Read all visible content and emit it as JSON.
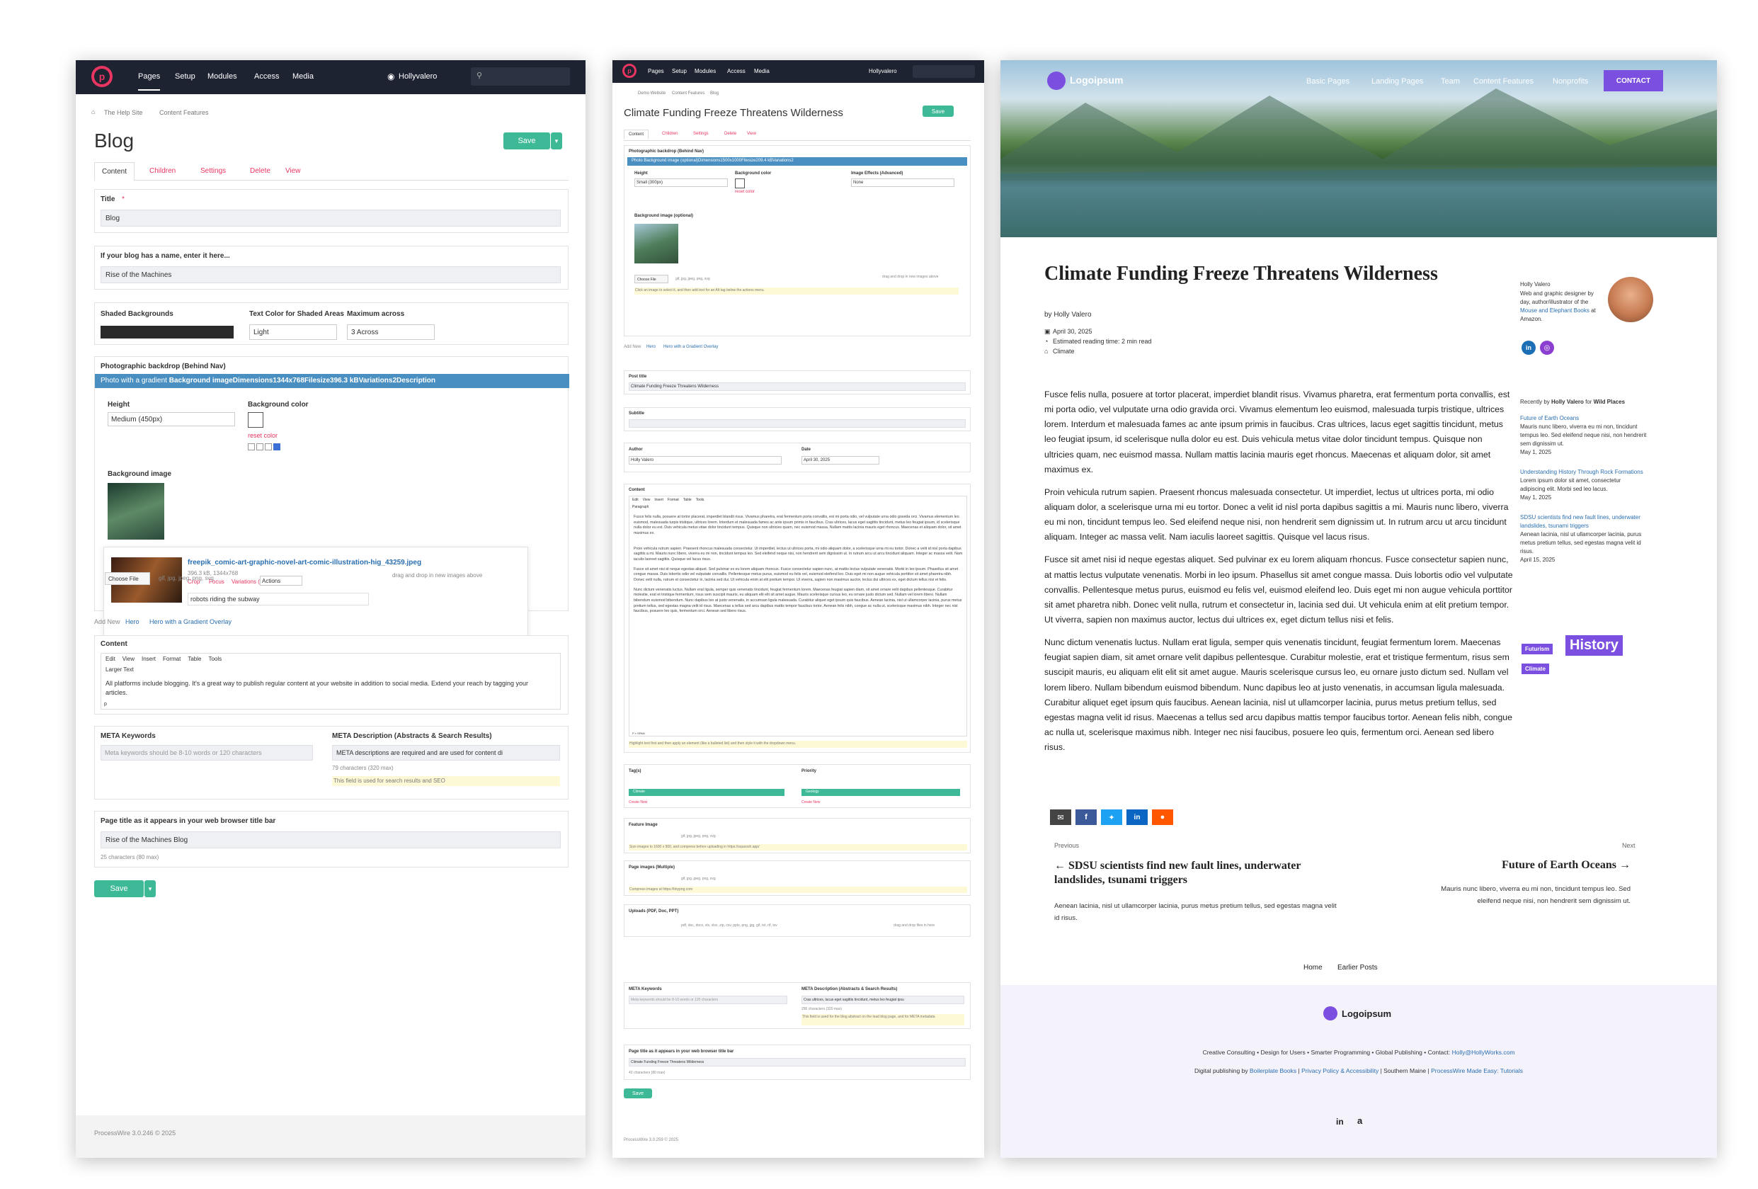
{
  "p1": {
    "nav": {
      "items": [
        "Pages",
        "Setup",
        "Modules",
        "Access",
        "Media"
      ],
      "user": "Hollyvalero"
    },
    "breadcrumb": [
      "The Help Site",
      "Content Features"
    ],
    "page_title": "Blog",
    "save": "Save",
    "tabs": [
      "Content",
      "Children",
      "Settings",
      "Delete",
      "View"
    ],
    "title_label": "Title",
    "title_value": "Blog",
    "blogname_label": "If your blog has a name, enter it here...",
    "blogname_value": "Rise of the Machines",
    "shaded_label": "Shaded Backgrounds",
    "textcolor_label": "Text Color for Shaded Areas",
    "textcolor_value": "Light",
    "maxacross_label": "Maximum across",
    "maxacross_value": "3 Across",
    "photo_label": "Photographic backdrop (Behind Nav)",
    "photo_bar_prefix": "Photo with a gradient",
    "photo_bar_rest": "Background imageDimensions1344x768Filesize396.3 kBVariations2Description",
    "height_label": "Height",
    "height_value": "Medium (450px)",
    "bgcolor_label": "Background color",
    "reset_color": "reset color",
    "bgimage_label": "Background image",
    "file_name": "freepik_comic-art-graphic-novel-art-comic-illustration-hig_43259.jpeg",
    "file_meta": "396.3 kB, 1344x768",
    "crop": "Crop",
    "focus": "Focus",
    "variations": "Variations (2)",
    "actions": "Actions",
    "file_desc": "robots riding the subway",
    "choose_file": "Choose File",
    "file_types": "gif, jpg, jpeg, png, svg",
    "drag_drop": "drag and drop in new images above",
    "add_new": "Add New",
    "add_hero": "Hero",
    "add_hero_grad": "Hero with a Gradient Overlay",
    "content_label": "Content",
    "editor_menu": [
      "Edit",
      "View",
      "Insert",
      "Format",
      "Table",
      "Tools"
    ],
    "editor_style": "Larger Text",
    "editor_text": "All platforms include blogging. It's a great way to publish regular content at your website in addition to social media. Extend your reach by tagging your articles.",
    "editor_path": "p",
    "meta_kw_label": "META Keywords",
    "meta_kw_ph": "Meta keywords should be 8-10 words or 120 characters",
    "meta_desc_label": "META Description (Abstracts & Search Results)",
    "meta_desc_value": "META descriptions are required and are used for content di",
    "meta_desc_count": "79 characters (320 max)",
    "meta_desc_note": "This field is used for search results and SEO",
    "browser_title_label": "Page title as it appears in your web browser title bar",
    "browser_title_value": "Rise of the Machines Blog",
    "browser_title_count": "25 characters (80 max)",
    "footer": "ProcessWire 3.0.246 © 2025"
  },
  "p2": {
    "nav": {
      "items": [
        "Pages",
        "Setup",
        "Modules",
        "Access",
        "Media"
      ],
      "user": "Hollyvalero"
    },
    "breadcrumb": [
      "Demo Website",
      "Content Features",
      "Blog"
    ],
    "page_title": "Climate Funding Freeze Threatens Wilderness",
    "save": "Save",
    "tabs": [
      "Content",
      "Children",
      "Settings",
      "Delete",
      "View"
    ],
    "photo_label": "Photographic backdrop (Behind Nav)",
    "photo_bar": "Photo Background image (optional)Dimensions1500x1000Filesize209.4 kBVariations2",
    "height_label": "Height",
    "height_value": "Small (300px)",
    "bgcolor_label": "Background color",
    "reset_color": "reset color",
    "effects_label": "Image Effects (Advanced)",
    "effects_value": "None",
    "bgimage_label": "Background image (optional)",
    "choose_file": "Choose File",
    "file_types": "gif, jpg, jpeg, png, svg",
    "drag_drop": "drag and drop in new images above",
    "click_note": "Click an image to select it, and then add text for an Alt tag below the actions menu.",
    "add_new": "Add New",
    "add_hero": "Hero",
    "add_hero_grad": "Hero with a Gradient Overlay",
    "post_title_label": "Post title",
    "post_title_value": "Climate Funding Freeze Threatens Wilderness",
    "subtitle_label": "Subtitle",
    "author_label": "Author",
    "author_value": "Holly Valero",
    "date_label": "Date",
    "date_value": "April 30, 2025",
    "content_label": "Content",
    "editor_menu": [
      "Edit",
      "View",
      "Insert",
      "Format",
      "Table",
      "Tools"
    ],
    "editor_style": "Paragraph",
    "para1": "Fusce felis nulla, posuere at tortor placerat, imperdiet blandit risus. Vivamus pharetra, erat fermentum porta convallis, est mi porta odio, vel vulputate urna odio gravida orci. Vivamus elementum leo euismod, malesuada turpis tristique, ultrices lorem. Interdum et malesuada fames ac ante ipsum primis in faucibus. Cras ultrices, lacus eget sagittis tincidunt, metus leo feugiat ipsum, id scelerisque nulla dolor eu est. Duis vehicula metus vitae dolor tincidunt tempus. Quisque non ultricies quam, nec euismod massa. Nullam mattis lacinia mauris eget rhoncus. Maecenas et aliquam dolor, sit amet maximus ex.",
    "para2": "Proin vehicula rutrum sapien. Praesent rhoncus malesuada consectetur. Ut imperdiet, lectus ut ultrices porta, mi odio aliquam dolor, a scelerisque urna mi eu tortor. Donec a velit id nisl porta dapibus sagittis a mi. Mauris nunc libero, viverra eu mi non, tincidunt tempus leo. Sed eleifend neque nisi, non hendrerit sem dignissim ut. In rutrum arcu ut arcu tincidunt aliquam. Integer ac massa velit. Nam iaculis laoreet sagittis. Quisque vel lacus risus.",
    "para3": "Fusce sit amet nisi id neque egestas aliquet. Sed pulvinar ex eu lorem aliquam rhoncus. Fusce consectetur sapien nunc, at mattis lectus vulputate venenatis. Morbi in leo ipsum. Phasellus sit amet congue massa. Duis lobortis odio vel vulputate convallis. Pellentesque metus purus, euismod eu felis vel, euismod eleifend leo. Duis eget mi non augue vehicula porttitor sit amet pharetra nibh. Donec velit nulla, rutrum et consectetur in, lacinia sed dui. Ut vehicula enim at elit pretium tempor. Ut viverra, sapien non maximus auctor, lectus dui ultrices ex, eget dictum tellus nisi et felis.",
    "para4": "Nunc dictum venenatis luctus. Nullam erat ligula, semper quis venenatis tincidunt, feugiat fermentum lorem. Maecenas feugiat sapien diam, sit amet ornare velit dapibus pellentesque. Curabitur molestie, erat et tristique fermentum, risus sem suscipit mauris, eu aliquam elit elit sit amet augue. Mauris scelerisque cursus leo, eu ornare justo dictum sed. Nullam vel lorem libero. Nullam bibendum euismod bibendum. Nunc dapibus leo at justo venenatis, in accumsan ligula malesuada. Curabitur aliquet eget ipsum quis faucibus. Aenean lacinia, nisl ut ullamcorper lacinia, purus metus pretium tellus, sed egestas magna velit id risus. Maecenas a tellus sed arcu dapibus mattis tempor faucibus tortor. Aenean felis nibh, congue ac nulla ut, scelerisque maximus nibh. Integer nec nisi faucibus, posuere leo quis, fermentum orci. Aenean sed libero risus.",
    "editor_path": "P » SPAN",
    "editor_note": "Highlight text first and then apply an element (like a bulleted list) and then style it with the dropdown menu.",
    "tags_label": "Tag(s)",
    "tag_value": "Climate",
    "create_new": "Create New",
    "priority_label": "Priority",
    "priority_value": "Geology",
    "feature_label": "Feature Image",
    "feature_types": "gif, jpg, jpeg, png, svg",
    "feature_note": "Size images to 1600 x 900, and compress before uploading in https://squoosh.app/",
    "pageimages_label": "Page images (Multiple)",
    "pageimages_types": "gif, jpg, jpeg, png, svg",
    "pageimages_note": "Compress images at https://tinypng.com",
    "uploads_label": "Uploads (PDF, Doc, PPT)",
    "uploads_types": "pdf, doc, docx, xls, xlsx, zip, csv, pptx, png, jpg, gif, txt, rtf, tsv",
    "uploads_drag": "drag and drop files in here",
    "meta_kw_label": "META Keywords",
    "meta_kw_ph": "Meta keywords should be 8-10 words or 120 characters",
    "meta_desc_label": "META Description (Abstracts & Search Results)",
    "meta_desc_value": "Cras ultrices, lacus eget sagittis tincidunt, metus leo feugiat ipsu",
    "meta_desc_count": "290 characters (320 max)",
    "meta_desc_note": "This field is used for the blog abstract on the lead blog page, and for META metadata",
    "browser_title_label": "Page title as it appears in your web browser title bar",
    "browser_title_value": "Climate Funding Freeze Threatens Wilderness",
    "browser_title_count": "43 characters (80 max)",
    "footer": "ProcessWire 3.0.259 © 2025"
  },
  "p3": {
    "logo": "Logoipsum",
    "nav": [
      "Basic Pages",
      "Landing Pages",
      "Team",
      "Content Features",
      "Nonprofits"
    ],
    "contact": "CONTACT",
    "title": "Climate Funding Freeze Threatens Wilderness",
    "byline": "by Holly Valero",
    "date": "April 30, 2025",
    "reading": "Estimated reading time: 2 min read",
    "tag": "Climate",
    "para1": "Fusce felis nulla, posuere at tortor placerat, imperdiet blandit risus. Vivamus pharetra, erat fermentum porta convallis, est mi porta odio, vel vulputate urna odio gravida orci. Vivamus elementum leo euismod, malesuada turpis tristique, ultrices lorem. Interdum et malesuada fames ac ante ipsum primis in faucibus. Cras ultrices, lacus eget sagittis tincidunt, metus leo feugiat ipsum, id scelerisque nulla dolor eu est. Duis vehicula metus vitae dolor tincidunt tempus. Quisque non ultricies quam, nec euismod massa. Nullam mattis lacinia mauris eget rhoncus. Maecenas et aliquam dolor, sit amet maximus ex.",
    "para2": "Proin vehicula rutrum sapien. Praesent rhoncus malesuada consectetur. Ut imperdiet, lectus ut ultrices porta, mi odio aliquam dolor, a scelerisque urna mi eu tortor. Donec a velit id nisl porta dapibus sagittis a mi. Mauris nunc libero, viverra eu mi non, tincidunt tempus leo. Sed eleifend neque nisi, non hendrerit sem dignissim ut. In rutrum arcu ut arcu tincidunt aliquam. Integer ac massa velit. Nam iaculis laoreet sagittis. Quisque vel lacus risus.",
    "para3": "Fusce sit amet nisi id neque egestas aliquet. Sed pulvinar ex eu lorem aliquam rhoncus. Fusce consectetur sapien nunc, at mattis lectus vulputate venenatis. Morbi in leo ipsum. Phasellus sit amet congue massa. Duis lobortis odio vel vulputate convallis. Pellentesque metus purus, euismod eu felis vel, euismod eleifend leo. Duis eget mi non augue vehicula porttitor sit amet pharetra nibh. Donec velit nulla, rutrum et consectetur in, lacinia sed dui. Ut vehicula enim at elit pretium tempor. Ut viverra, sapien non maximus auctor, lectus dui ultrices ex, eget dictum tellus nisi et felis.",
    "para4": "Nunc dictum venenatis luctus. Nullam erat ligula, semper quis venenatis tincidunt, feugiat fermentum lorem. Maecenas feugiat sapien diam, sit amet ornare velit dapibus pellentesque. Curabitur molestie, erat et tristique fermentum, risus sem suscipit mauris, eu aliquam elit elit sit amet augue. Mauris scelerisque cursus leo, eu ornare justo dictum sed. Nullam vel lorem libero. Nullam bibendum euismod bibendum. Nunc dapibus leo at justo venenatis, in accumsan ligula malesuada. Curabitur aliquet eget ipsum quis faucibus. Aenean lacinia, nisl ut ullamcorper lacinia, purus metus pretium tellus, sed egestas magna velit id risus. Maecenas a tellus sed arcu dapibus mattis tempor faucibus tortor. Aenean felis nibh, congue ac nulla ut, scelerisque maximus nibh. Integer nec nisi faucibus, posuere leo quis, fermentum orci. Aenean sed libero risus.",
    "author_name": "Holly Valero",
    "author_bio": "Web and graphic designer by day, author/illustrator of the",
    "author_book": "Mouse and Elephant Books",
    "author_bio_end": "at Amazon.",
    "recent_label_pre": "Recently by",
    "recent_author": "Holly Valero",
    "recent_for": "for",
    "recent_cat": "Wild Places",
    "recent": [
      {
        "title": "Future of Earth Oceans",
        "excerpt": "Mauris nunc libero, viverra eu mi non, tincidunt tempus leo. Sed eleifend neque nisi, non hendrerit sem dignissim ut.",
        "date": "May 1, 2025"
      },
      {
        "title": "Understanding History Through Rock Formations",
        "excerpt": "Lorem ipsum dolor sit amet, consectetur adipiscing elit. Morbi sed leo lacus.",
        "date": "May 1, 2025"
      },
      {
        "title": "SDSU scientists find new fault lines, underwater landslides, tsunami triggers",
        "excerpt": "Aenean lacinia, nisl ut ullamcorper lacinia, purus metus pretium tellus, sed egestas magna velit id risus.",
        "date": "April 15, 2025"
      }
    ],
    "tags": [
      "Futurism",
      "History",
      "Climate"
    ],
    "prev_label": "Previous",
    "prev_title": "← SDSU scientists find new fault lines, underwater landslides, tsunami triggers",
    "prev_excerpt": "Aenean lacinia, nisl ut ullamcorper lacinia, purus metus pretium tellus, sed egestas magna velit id risus.",
    "next_label": "Next",
    "next_title": "Future of Earth Oceans →",
    "next_excerpt": "Mauris nunc libero, viverra eu mi non, tincidunt tempus leo. Sed eleifend neque nisi, non hendrerit sem dignissim ut.",
    "footer_links": [
      "Home",
      "Earlier Posts"
    ],
    "footer_logo": "Logoipsum",
    "footer_line1": "Creative Consulting • Design for Users • Smarter Programming • Global Publishing • Contact:",
    "footer_email": "Holly@HollyWorks.com",
    "footer_line2_pre": "Digital publishing by",
    "footer_links2": [
      "Boilerplate Books",
      "Privacy Policy & Accessibility"
    ],
    "footer_place": "Southern Maine",
    "footer_pw": "ProcessWire Made Easy: Tutorials",
    "colors": {
      "accent": "#7b4fe0",
      "link": "#2a6fb0"
    }
  }
}
